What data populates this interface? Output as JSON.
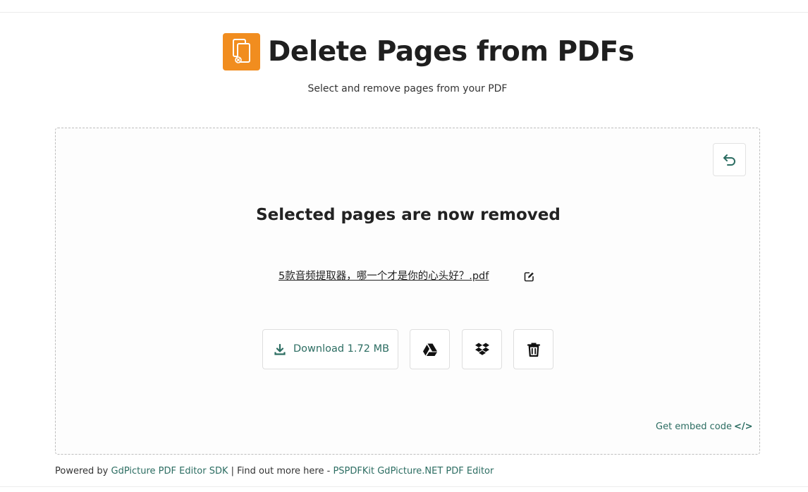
{
  "header": {
    "title": "Delete Pages from PDFs",
    "subtitle": "Select and remove pages from your PDF",
    "logo_color": "#f18d1f",
    "logo_icon": "pdf-pages-icon"
  },
  "panel": {
    "status_text": "Selected pages are now removed",
    "file_name": "5款音频提取器，哪一个才是你的心头好？.pdf",
    "undo_icon": "undo-icon",
    "edit_icon": "edit-icon",
    "actions": {
      "download_label": "Download 1.72 MB",
      "download_icon": "download-icon",
      "gdrive_icon": "google-drive-icon",
      "dropbox_icon": "dropbox-icon",
      "delete_icon": "trash-icon"
    },
    "embed_label": "Get embed code",
    "embed_icon_glyph": "</>"
  },
  "footer": {
    "prefix": "Powered by",
    "sdk_link": "GdPicture PDF Editor SDK",
    "separator": "| Find out more here -",
    "more_link": "PSPDFKit GdPicture.NET PDF Editor"
  },
  "colors": {
    "accent": "#2c6d62",
    "brand_orange": "#f18d1f"
  }
}
